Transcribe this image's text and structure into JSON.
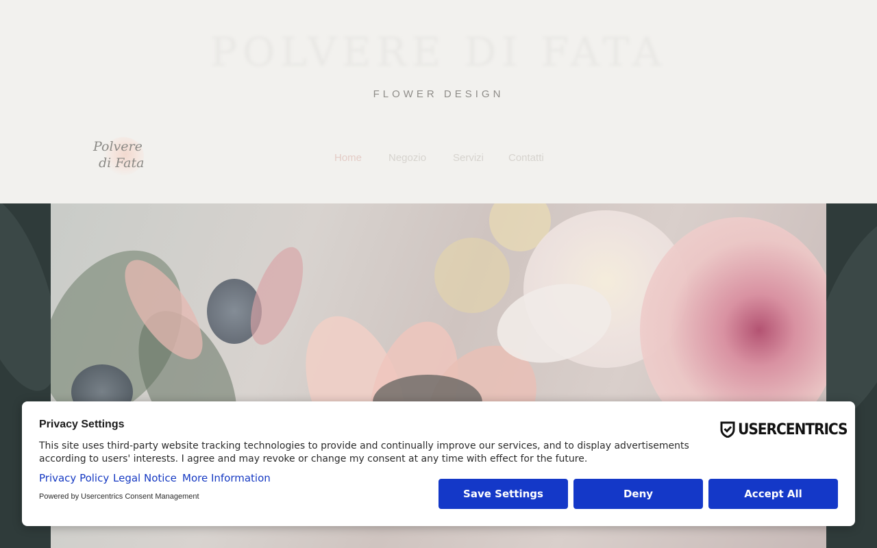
{
  "header": {
    "site_title": "POLVERE DI FATA",
    "site_subtitle": "FLOWER DESIGN",
    "logo_line1": "Polvere",
    "logo_line2": "di Fata"
  },
  "nav": {
    "items": [
      {
        "label": "Home",
        "active": true
      },
      {
        "label": "Negozio",
        "active": false
      },
      {
        "label": "Servizi",
        "active": false
      },
      {
        "label": "Contatti",
        "active": false
      }
    ]
  },
  "consent": {
    "title": "Privacy Settings",
    "body": "This site uses third-party website tracking technologies to provide and continually improve our services, and to display advertisements according to users' interests. I agree and may revoke or change my consent at any time with effect for the future.",
    "links": {
      "privacy_policy": "Privacy Policy",
      "legal_notice": "Legal Notice",
      "more_information": "More Information"
    },
    "powered_by": "Powered by Usercentrics Consent Management",
    "brand": "USERCENTRICS",
    "buttons": {
      "save_settings": "Save Settings",
      "deny": "Deny",
      "accept_all": "Accept All"
    }
  },
  "colors": {
    "header_bg": "#f2f1ee",
    "button_blue": "#1438c8",
    "link_blue": "#1438c2",
    "hero_dark": "#2f3b3a"
  },
  "icons": {
    "usercentrics_logo": "shield-check-icon"
  }
}
